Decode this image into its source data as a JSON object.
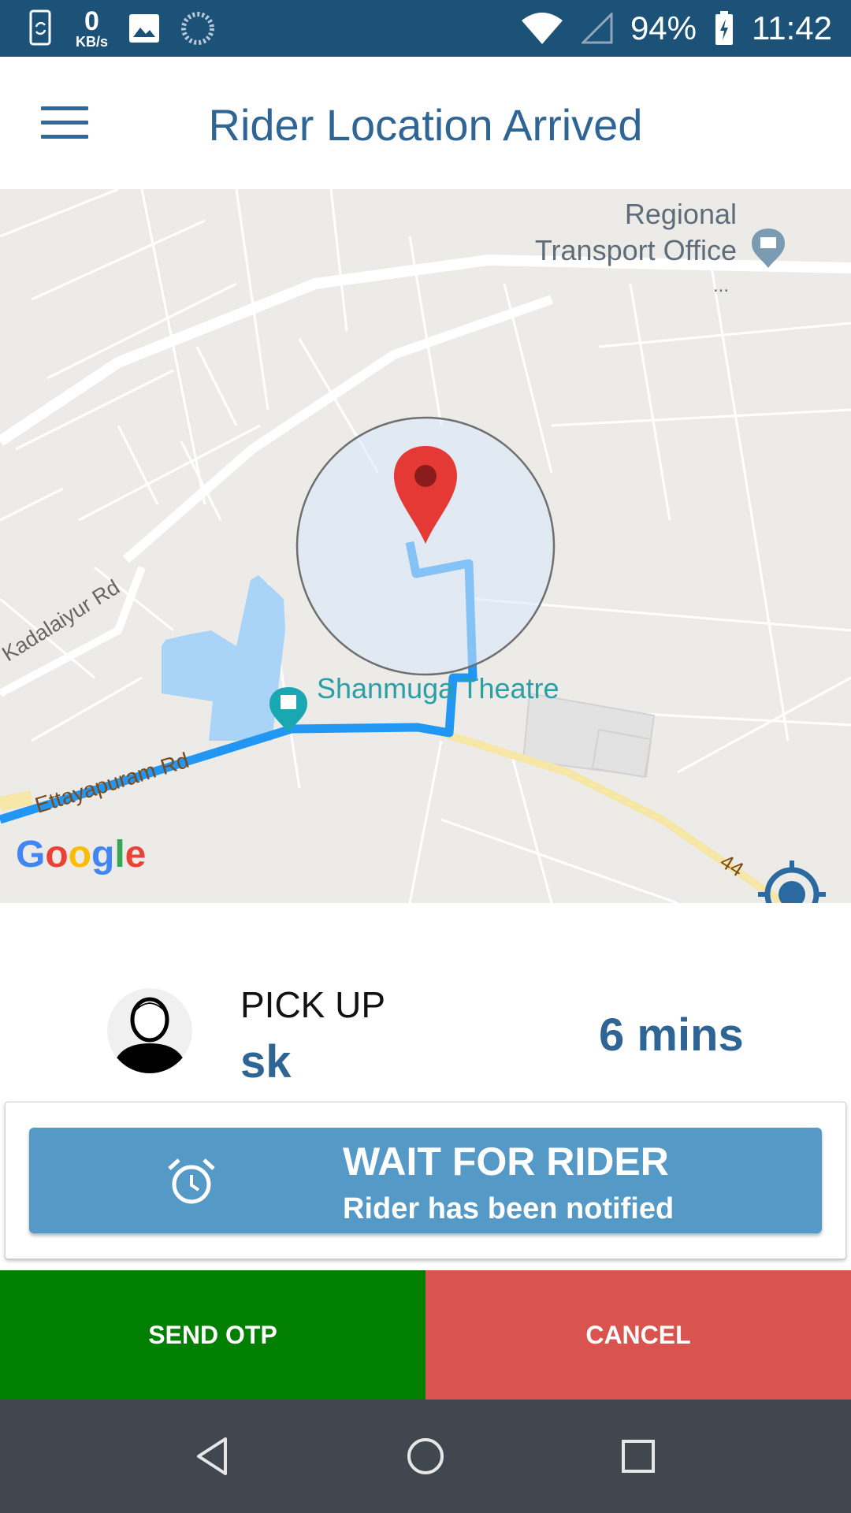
{
  "status_bar": {
    "net_speed_value": "0",
    "net_speed_unit": "KB/s",
    "battery": "94%",
    "time": "11:42",
    "icons": [
      "phone-sync-icon",
      "image-icon",
      "loading-icon",
      "wifi-icon",
      "signal-icon",
      "battery-charging-icon"
    ]
  },
  "header": {
    "title": "Rider Location Arrived",
    "menu_icon": "hamburger-menu-icon"
  },
  "map": {
    "labels": {
      "rto": "Regional\nTransport Office",
      "rto_more": "...",
      "kadalaiyur": "Kadalaiyur Rd",
      "ettayapuram": "Ettayapuram Rd",
      "theatre": "Shanmuga Theatre",
      "highway": "44"
    },
    "attribution": "Google",
    "colors": {
      "route": "#2196f3",
      "pin": "#e53935",
      "water": "#aad3f8",
      "highway": "#f6e7a7"
    },
    "my_location_icon": "my-location-icon"
  },
  "pickup": {
    "label": "PICK UP",
    "rider_name": "sk",
    "eta": "6 mins",
    "avatar_icon": "user-avatar-icon"
  },
  "wait_button": {
    "title": "WAIT FOR RIDER",
    "subtitle": "Rider has been notified",
    "icon": "alarm-clock-icon"
  },
  "actions": {
    "send_otp": "SEND OTP",
    "cancel": "CANCEL",
    "colors": {
      "send_otp": "#007f00",
      "cancel": "#d9534f"
    }
  },
  "nav_bar": {
    "icons": [
      "back-icon",
      "home-icon",
      "recents-icon"
    ]
  }
}
